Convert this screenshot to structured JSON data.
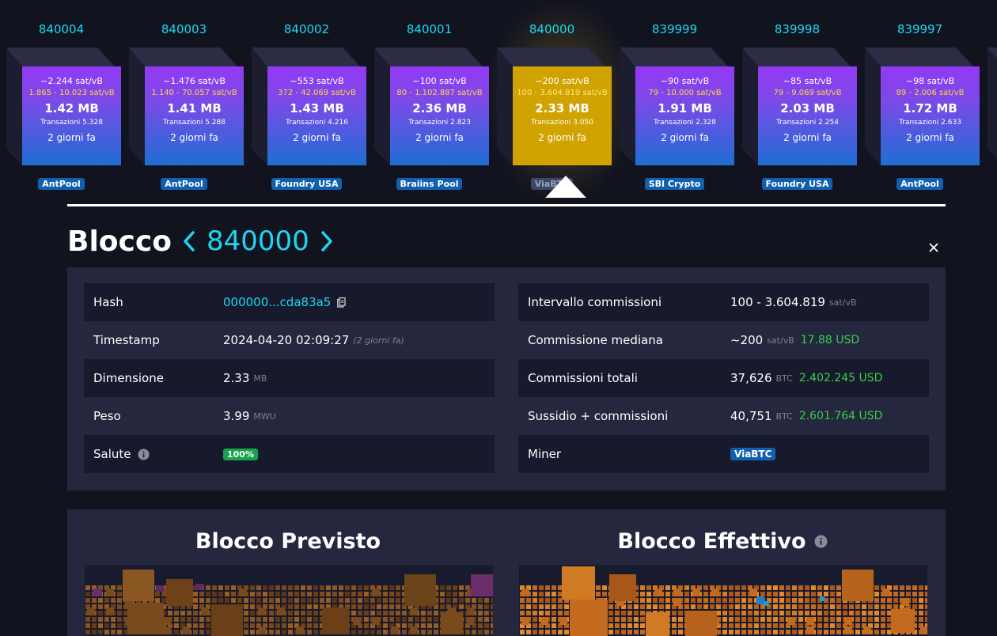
{
  "blocks": [
    {
      "height": "840004",
      "fee": "~2.244 sat/vB",
      "span": "1.865 - 10.023 sat/vB",
      "size": "1.42 MB",
      "tx": "Transazioni 5.328",
      "ago": "2 giorni fa",
      "pool": "AntPool"
    },
    {
      "height": "840003",
      "fee": "~1.476 sat/vB",
      "span": "1.140 - 70.057 sat/vB",
      "size": "1.41 MB",
      "tx": "Transazioni 5.288",
      "ago": "2 giorni fa",
      "pool": "AntPool"
    },
    {
      "height": "840002",
      "fee": "~553 sat/vB",
      "span": "372 - 42.069 sat/vB",
      "size": "1.43 MB",
      "tx": "Transazioni 4.216",
      "ago": "2 giorni fa",
      "pool": "Foundry USA"
    },
    {
      "height": "840001",
      "fee": "~100 sat/vB",
      "span": "80 - 1.102.887 sat/vB",
      "size": "2.36 MB",
      "tx": "Transazioni 2.823",
      "ago": "2 giorni fa",
      "pool": "Braiins Pool"
    },
    {
      "height": "840000",
      "fee": "~200 sat/vB",
      "span": "100 - 3.604.819 sat/vB",
      "size": "2.33 MB",
      "tx": "Transazioni 3.050",
      "ago": "2 giorni fa",
      "pool": "ViaBTC"
    },
    {
      "height": "839999",
      "fee": "~90 sat/vB",
      "span": "79 - 10.000 sat/vB",
      "size": "1.91 MB",
      "tx": "Transazioni 2.328",
      "ago": "2 giorni fa",
      "pool": "SBI Crypto"
    },
    {
      "height": "839998",
      "fee": "~85 sat/vB",
      "span": "79 - 9.069 sat/vB",
      "size": "2.03 MB",
      "tx": "Transazioni 2.254",
      "ago": "2 giorni fa",
      "pool": "Foundry USA"
    },
    {
      "height": "839997",
      "fee": "~98 sat/vB",
      "span": "89 - 2.006 sat/vB",
      "size": "1.72 MB",
      "tx": "Transazioni 2.633",
      "ago": "2 giorni fa",
      "pool": "AntPool"
    }
  ],
  "header": {
    "title": "Blocco",
    "height": "840000"
  },
  "details": {
    "hash": {
      "label": "Hash",
      "value": "000000...cda83a5"
    },
    "timestamp": {
      "label": "Timestamp",
      "value": "2024-04-20 02:09:27",
      "ago": "(2 giorni fa)"
    },
    "size": {
      "label": "Dimensione",
      "value": "2.33",
      "unit": "MB"
    },
    "weight": {
      "label": "Peso",
      "value": "3.99",
      "unit": "MWU"
    },
    "health": {
      "label": "Salute",
      "value": "100%"
    },
    "fee_range": {
      "label": "Intervallo commissioni",
      "value": "100 - 3.604.819",
      "unit": "sat/vB"
    },
    "median_fee": {
      "label": "Commissione mediana",
      "value": "~200",
      "unit": "sat/vB",
      "usd": "17.88 USD"
    },
    "total_fees": {
      "label": "Commissioni totali",
      "value": "37,626",
      "unit": "BTC",
      "usd": "2.402.245 USD"
    },
    "subsidy": {
      "label": "Sussidio + commissioni",
      "value": "40,751",
      "unit": "BTC",
      "usd": "2.601.764 USD"
    },
    "miner": {
      "label": "Miner",
      "value": "ViaBTC"
    }
  },
  "overview": {
    "expected": "Blocco Previsto",
    "actual": "Blocco Effettivo"
  },
  "colors": {
    "accent": "#1bd8f4",
    "selected_block": "#d1a301",
    "usd": "#3bcc49",
    "panel": "#24273e",
    "pool_badge": "#105fb0"
  },
  "icons": {
    "copy": "copy-icon",
    "info": "info-icon",
    "close": "close-icon",
    "prev": "chevron-left-icon",
    "next": "chevron-right-icon"
  }
}
